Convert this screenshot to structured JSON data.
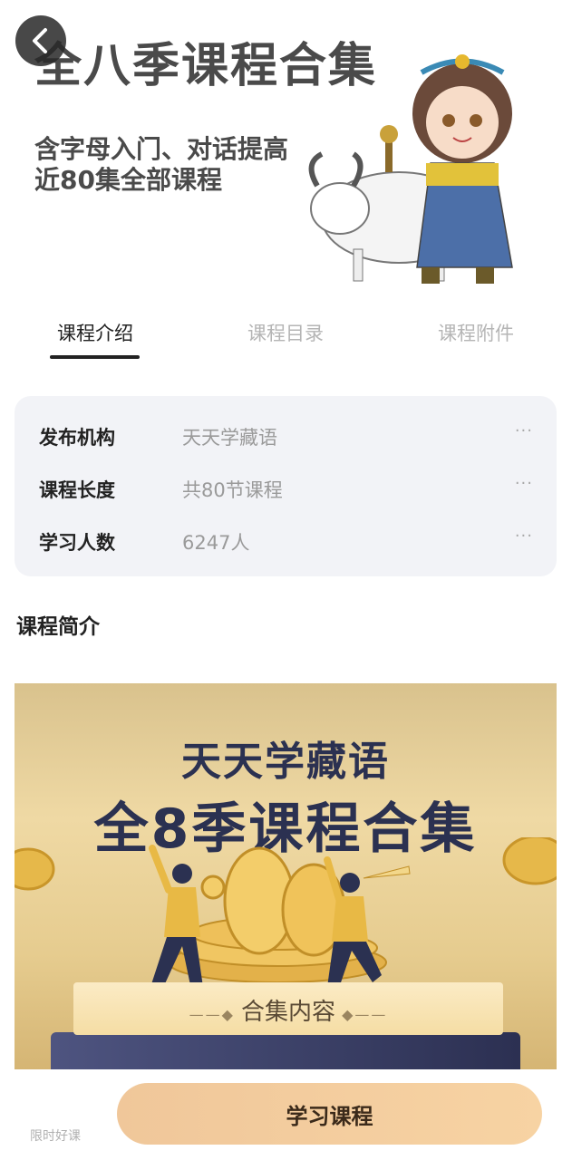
{
  "hero": {
    "title": "全八季课程合集",
    "subtitle_line1": "含字母入门、对话提高",
    "subtitle_line2": "近80集全部课程"
  },
  "header": {
    "back_icon": "chevron-left-icon"
  },
  "tabs": [
    {
      "label": "课程介绍",
      "active": true
    },
    {
      "label": "课程目录",
      "active": false
    },
    {
      "label": "课程附件",
      "active": false
    }
  ],
  "info": [
    {
      "label": "发布机构",
      "value": "天天学藏语",
      "more": "···"
    },
    {
      "label": "课程长度",
      "value": "共80节课程",
      "more": "···"
    },
    {
      "label": "学习人数",
      "value": "6247人",
      "more": "···"
    }
  ],
  "intro": {
    "title": "课程简介"
  },
  "poster": {
    "line1": "天天学藏语",
    "line2": "全8季课程合集",
    "box_label": "合集内容"
  },
  "bottom": {
    "tag": "限时好课",
    "button_label": "学习课程"
  },
  "colors": {
    "accent_button": "#f4cda0",
    "poster_navy": "#2b3151",
    "card_bg": "#f2f3f7"
  }
}
